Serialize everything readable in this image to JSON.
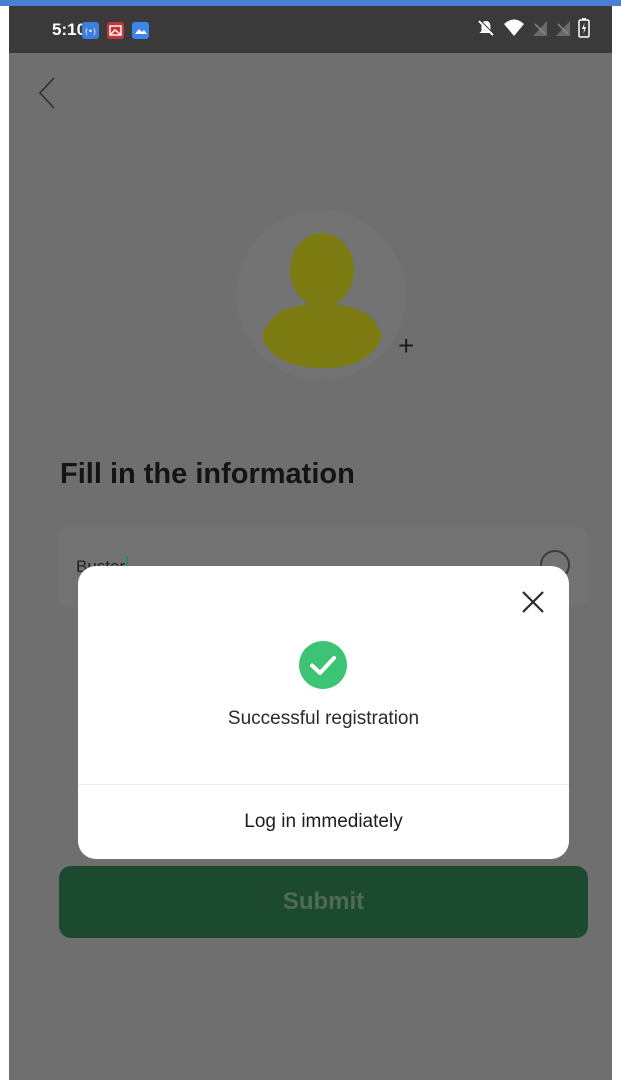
{
  "status_bar": {
    "time": "5:10",
    "notification_icons": [
      "wireless-icon",
      "image-icon",
      "gallery-icon"
    ],
    "system_icons": [
      "bell-off-icon",
      "wifi-icon",
      "signal-icon",
      "signal-icon",
      "battery-icon"
    ]
  },
  "page": {
    "back_icon": "chevron-left-icon",
    "avatar_icon": "user-icon",
    "add_photo_symbol": "+",
    "title": "Fill in the information",
    "name_field": {
      "value": "Buster",
      "trailing_icon": "clear-circle-icon"
    },
    "submit_label": "Submit"
  },
  "dialog": {
    "close_icon": "close-icon",
    "success_icon": "check-circle-icon",
    "message": "Successful registration",
    "action_label": "Log in immediately"
  },
  "colors": {
    "overlay_background": "#6f6f6f",
    "submit_background": "#1c4a2e",
    "avatar": "#7c7c12",
    "success_green": "#3cc373"
  }
}
